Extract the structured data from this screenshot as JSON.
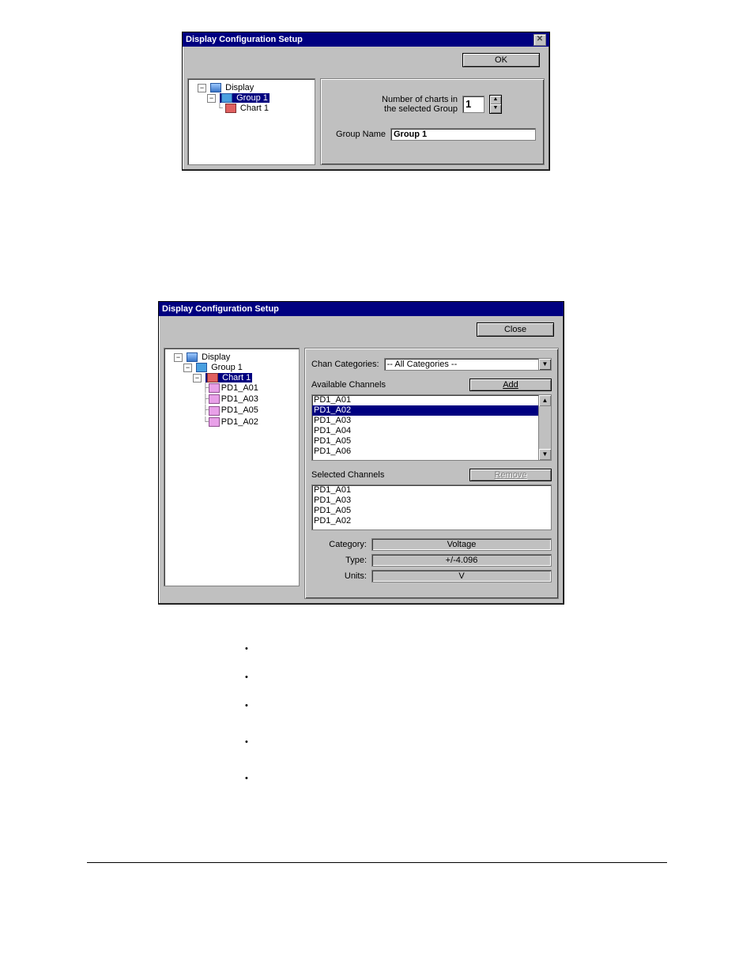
{
  "dialog1": {
    "title": "Display Configuration  Setup",
    "ok": "OK",
    "tree": {
      "root": "Display",
      "group": "Group 1",
      "chart": "Chart 1"
    },
    "chartsLabel1": "Number of charts in",
    "chartsLabel2": "the selected Group",
    "chartsValue": "1",
    "groupNameLabel": "Group Name",
    "groupNameValue": "Group 1"
  },
  "dialog2": {
    "title": "Display Configuration Setup",
    "close": "Close",
    "tree": {
      "root": "Display",
      "group": "Group 1",
      "chart": "Chart 1",
      "chans": [
        "PD1_A01",
        "PD1_A03",
        "PD1_A05",
        "PD1_A02"
      ]
    },
    "chanCatLabel": "Chan Categories:",
    "chanCatValue": "-- All Categories --",
    "availLabel": "Available Channels",
    "addLabel": "Add",
    "avail": [
      "PD1_A01",
      "PD1_A02",
      "PD1_A03",
      "PD1_A04",
      "PD1_A05",
      "PD1_A06"
    ],
    "selLabel": "Selected Channels",
    "removeLabel": "Remove",
    "selected": [
      "PD1_A01",
      "PD1_A03",
      "PD1_A05",
      "PD1_A02"
    ],
    "catLabel": "Category:",
    "catValue": "Voltage",
    "typeLabel": "Type:",
    "typeValue": "+/-4.096",
    "unitsLabel": "Units:",
    "unitsValue": "V"
  }
}
